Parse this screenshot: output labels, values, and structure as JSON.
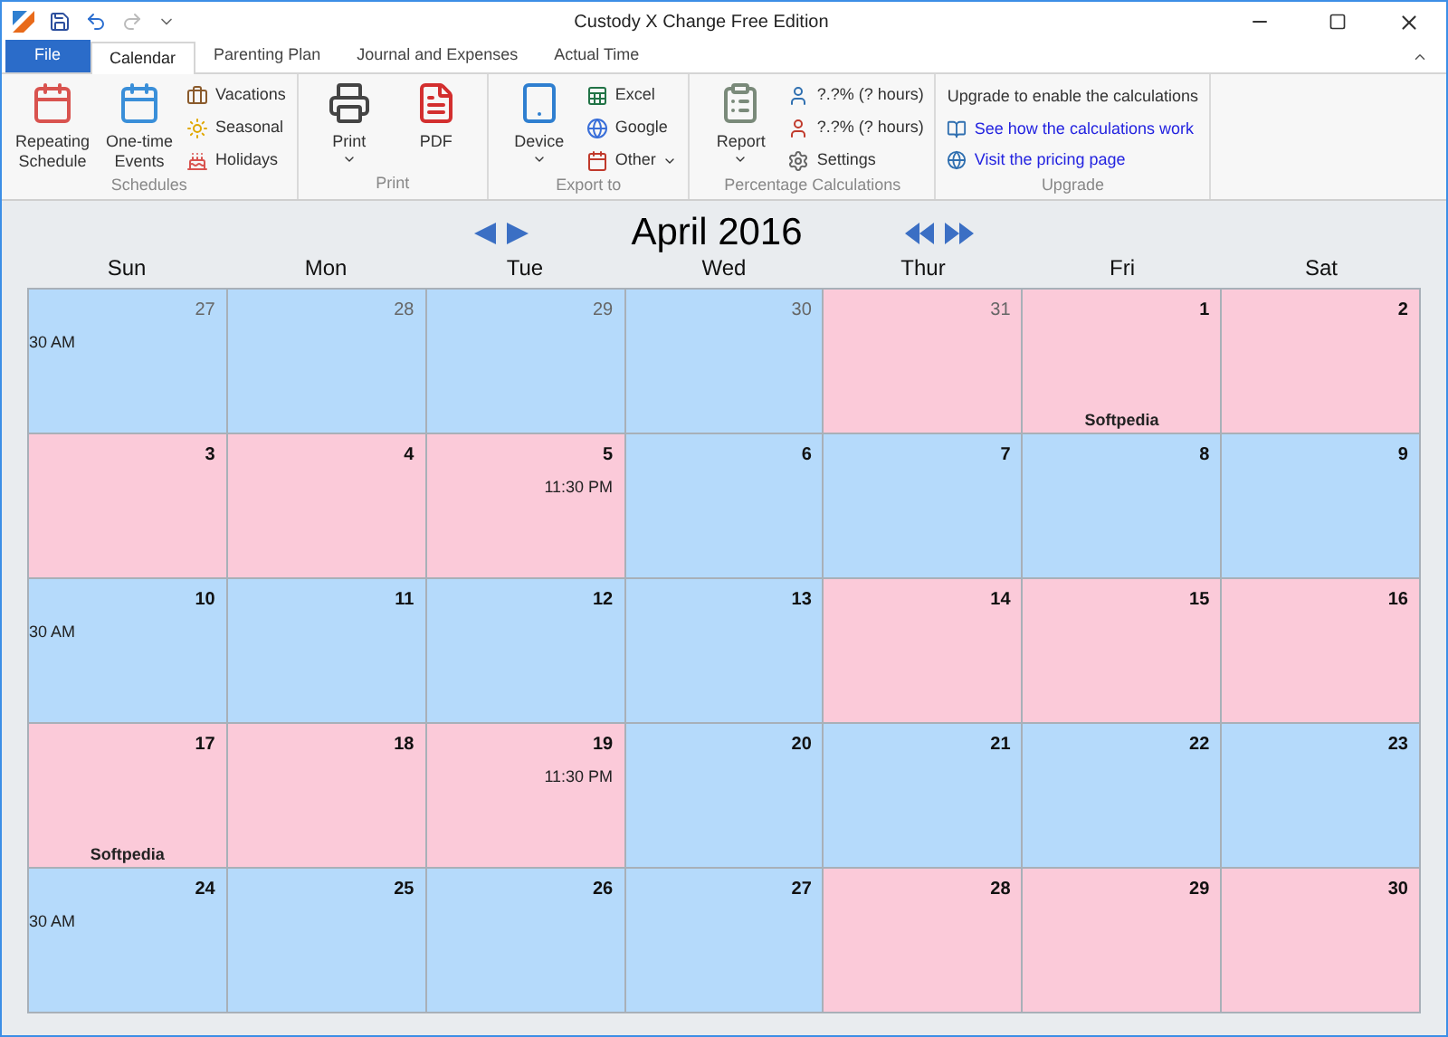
{
  "window": {
    "title": "Custody X Change Free Edition"
  },
  "file_button": "File",
  "tabs": [
    {
      "label": "Calendar",
      "selected": true
    },
    {
      "label": "Parenting Plan",
      "selected": false
    },
    {
      "label": "Journal and Expenses",
      "selected": false
    },
    {
      "label": "Actual Time",
      "selected": false
    }
  ],
  "ribbon": [
    {
      "group": "Schedules",
      "large": [
        {
          "label": "Repeating Schedule",
          "menu": false
        },
        {
          "label": "One-time Events",
          "menu": false
        }
      ],
      "small": [
        {
          "label": "Vacations",
          "menu": false
        },
        {
          "label": "Seasonal",
          "menu": false
        },
        {
          "label": "Holidays",
          "menu": false
        }
      ]
    },
    {
      "group": "Print",
      "large": [
        {
          "label": "Print",
          "menu": true
        },
        {
          "label": "PDF",
          "menu": false
        }
      ]
    },
    {
      "group": "Export to",
      "large": [
        {
          "label": "Device",
          "menu": true
        }
      ],
      "small": [
        {
          "label": "Excel",
          "menu": false
        },
        {
          "label": "Google",
          "menu": false
        },
        {
          "label": "Other",
          "menu": true
        }
      ]
    },
    {
      "group": "Percentage Calculations",
      "large": [
        {
          "label": "Report",
          "menu": true
        }
      ],
      "small": [
        {
          "label": "?.?% (? hours)",
          "menu": false
        },
        {
          "label": "?.?% (? hours)",
          "menu": false
        },
        {
          "label": "Settings",
          "menu": false
        }
      ]
    },
    {
      "group": "Upgrade",
      "note": "Upgrade to enable the calculations",
      "links": [
        {
          "label": "See how the calculations work"
        },
        {
          "label": "Visit the pricing page"
        }
      ]
    }
  ],
  "calendar": {
    "title": "April 2016",
    "weekdays": [
      "Sun",
      "Mon",
      "Tue",
      "Wed",
      "Thur",
      "Fri",
      "Sat"
    ],
    "weeks": [
      [
        {
          "day": "27",
          "in_month": false,
          "color": "#b5dafb",
          "time": "30 AM"
        },
        {
          "day": "28",
          "in_month": false,
          "color": "#b5dafb"
        },
        {
          "day": "29",
          "in_month": false,
          "color": "#b5dafb"
        },
        {
          "day": "30",
          "in_month": false,
          "color": "#b5dafb"
        },
        {
          "day": "31",
          "in_month": false,
          "color": "#fbcad9"
        },
        {
          "day": "1",
          "in_month": true,
          "color": "#fbcad9",
          "label": "Softpedia"
        },
        {
          "day": "2",
          "in_month": true,
          "color": "#fbcad9"
        }
      ],
      [
        {
          "day": "3",
          "in_month": true,
          "color": "#fbcad9"
        },
        {
          "day": "4",
          "in_month": true,
          "color": "#fbcad9"
        },
        {
          "day": "5",
          "in_month": true,
          "color": "#fbcad9",
          "time": "11:30 PM"
        },
        {
          "day": "6",
          "in_month": true,
          "color": "#b5dafb"
        },
        {
          "day": "7",
          "in_month": true,
          "color": "#b5dafb"
        },
        {
          "day": "8",
          "in_month": true,
          "color": "#b5dafb"
        },
        {
          "day": "9",
          "in_month": true,
          "color": "#b5dafb"
        }
      ],
      [
        {
          "day": "10",
          "in_month": true,
          "color": "#b5dafb",
          "time": "30 AM"
        },
        {
          "day": "11",
          "in_month": true,
          "color": "#b5dafb"
        },
        {
          "day": "12",
          "in_month": true,
          "color": "#b5dafb"
        },
        {
          "day": "13",
          "in_month": true,
          "color": "#b5dafb"
        },
        {
          "day": "14",
          "in_month": true,
          "color": "#fbcad9"
        },
        {
          "day": "15",
          "in_month": true,
          "color": "#fbcad9"
        },
        {
          "day": "16",
          "in_month": true,
          "color": "#fbcad9"
        }
      ],
      [
        {
          "day": "17",
          "in_month": true,
          "color": "#fbcad9",
          "label": "Softpedia"
        },
        {
          "day": "18",
          "in_month": true,
          "color": "#fbcad9"
        },
        {
          "day": "19",
          "in_month": true,
          "color": "#fbcad9",
          "time": "11:30 PM"
        },
        {
          "day": "20",
          "in_month": true,
          "color": "#b5dafb"
        },
        {
          "day": "21",
          "in_month": true,
          "color": "#b5dafb"
        },
        {
          "day": "22",
          "in_month": true,
          "color": "#b5dafb"
        },
        {
          "day": "23",
          "in_month": true,
          "color": "#b5dafb"
        }
      ],
      [
        {
          "day": "24",
          "in_month": true,
          "color": "#b5dafb",
          "time": "30 AM"
        },
        {
          "day": "25",
          "in_month": true,
          "color": "#b5dafb"
        },
        {
          "day": "26",
          "in_month": true,
          "color": "#b5dafb"
        },
        {
          "day": "27",
          "in_month": true,
          "color": "#b5dafb"
        },
        {
          "day": "28",
          "in_month": true,
          "color": "#fbcad9"
        },
        {
          "day": "29",
          "in_month": true,
          "color": "#fbcad9"
        },
        {
          "day": "30",
          "in_month": true,
          "color": "#fbcad9"
        }
      ]
    ]
  }
}
